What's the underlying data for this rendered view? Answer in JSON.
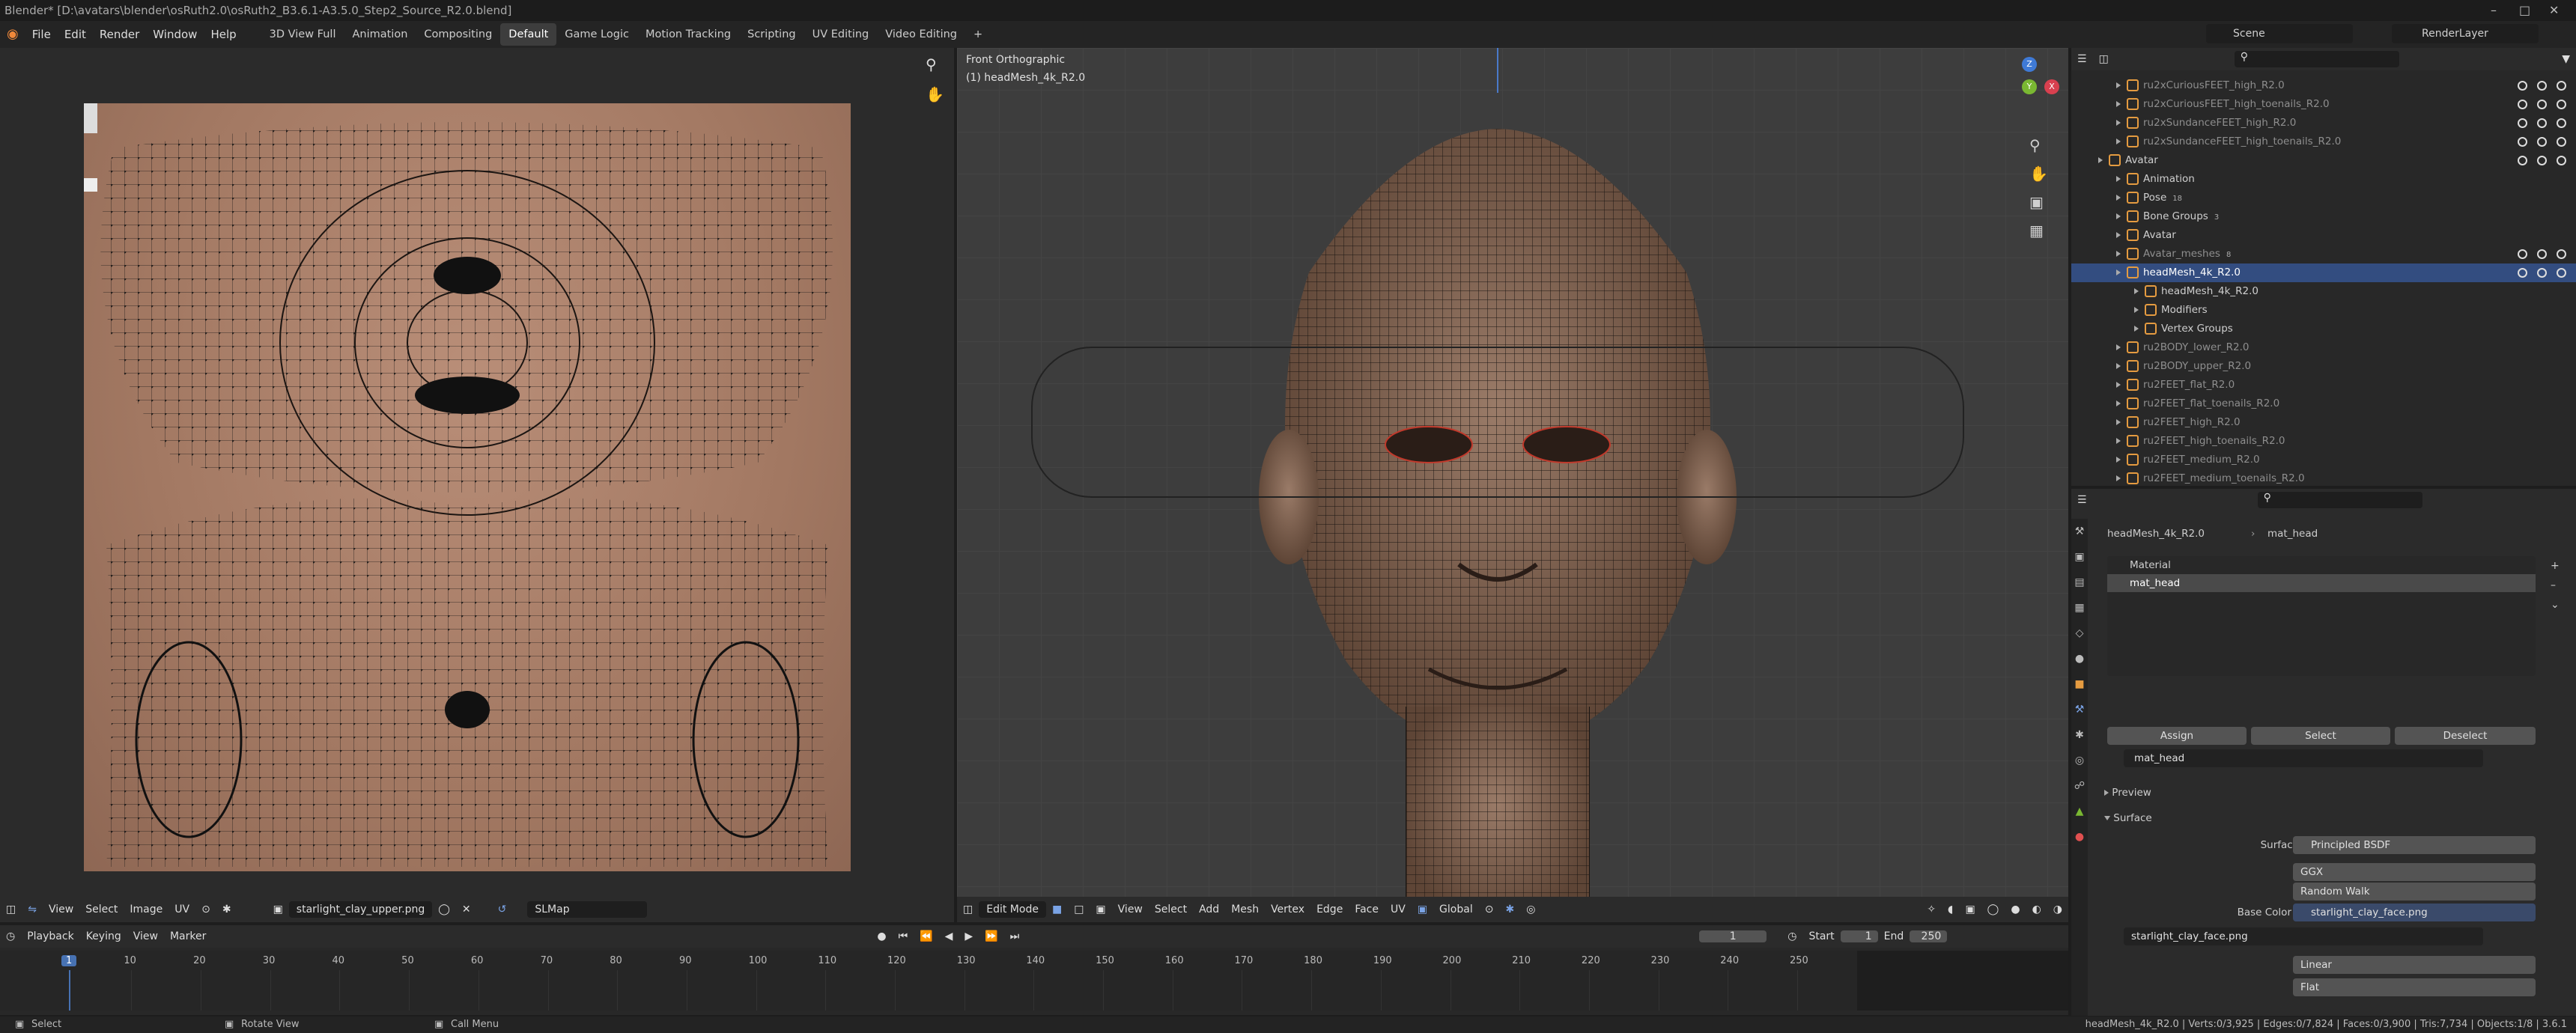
{
  "window": {
    "title": "Blender* [D:\\avatars\\blender\\osRuth2.0\\osRuth2_B3.6.1-A3.5.0_Step2_Source_R2.0.blend]"
  },
  "menu": [
    "File",
    "Edit",
    "Render",
    "Window",
    "Help"
  ],
  "workspaces": [
    "3D View Full",
    "Animation",
    "Compositing",
    "Default",
    "Game Logic",
    "Motion Tracking",
    "Scripting",
    "UV Editing",
    "Video Editing"
  ],
  "active_workspace": "Default",
  "scene": {
    "name": "Scene",
    "render_layer": "RenderLayer"
  },
  "uv_editor": {
    "menus": [
      "View",
      "Select",
      "Image",
      "UV"
    ],
    "image_name": "starlight_clay_upper.png",
    "uv_map": "SLMap"
  },
  "viewport": {
    "view_label": "Front Orthographic",
    "object_label": "(1) headMesh_4k_R2.0",
    "mode": "Edit Mode",
    "menus": [
      "View",
      "Select",
      "Add",
      "Mesh",
      "Vertex",
      "Edge",
      "Face",
      "UV"
    ],
    "orientation": "Global",
    "axes": {
      "x": "X",
      "y": "Y",
      "z": "Z"
    }
  },
  "outliner": {
    "rows": [
      {
        "label": "ru2xCuriousFEET_high_R2.0",
        "indent": 2,
        "dim": true
      },
      {
        "label": "ru2xCuriousFEET_high_toenails_R2.0",
        "indent": 2,
        "dim": true
      },
      {
        "label": "ru2xSundanceFEET_high_R2.0",
        "indent": 2,
        "dim": true
      },
      {
        "label": "ru2xSundanceFEET_high_toenails_R2.0",
        "indent": 2,
        "dim": true
      },
      {
        "label": "Avatar",
        "indent": 1,
        "dim": false
      },
      {
        "label": "Animation",
        "indent": 2,
        "dim": false
      },
      {
        "label": "Pose",
        "indent": 2,
        "dim": false,
        "badge": "18"
      },
      {
        "label": "Bone Groups",
        "indent": 2,
        "dim": false,
        "badge": "3"
      },
      {
        "label": "Avatar",
        "indent": 2,
        "dim": false
      },
      {
        "label": "Avatar_meshes",
        "indent": 2,
        "dim": true,
        "badge": "8"
      },
      {
        "label": "headMesh_4k_R2.0",
        "indent": 2,
        "dim": false,
        "selected": true
      },
      {
        "label": "headMesh_4k_R2.0",
        "indent": 3,
        "dim": false
      },
      {
        "label": "Modifiers",
        "indent": 3,
        "dim": false
      },
      {
        "label": "Vertex Groups",
        "indent": 3,
        "dim": false
      },
      {
        "label": "ru2BODY_lower_R2.0",
        "indent": 2,
        "dim": true
      },
      {
        "label": "ru2BODY_upper_R2.0",
        "indent": 2,
        "dim": true
      },
      {
        "label": "ru2FEET_flat_R2.0",
        "indent": 2,
        "dim": true
      },
      {
        "label": "ru2FEET_flat_toenails_R2.0",
        "indent": 2,
        "dim": true
      },
      {
        "label": "ru2FEET_high_R2.0",
        "indent": 2,
        "dim": true
      },
      {
        "label": "ru2FEET_high_toenails_R2.0",
        "indent": 2,
        "dim": true
      },
      {
        "label": "ru2FEET_medium_R2.0",
        "indent": 2,
        "dim": true
      },
      {
        "label": "ru2FEET_medium_toenails_R2.0",
        "indent": 2,
        "dim": true
      }
    ]
  },
  "properties": {
    "breadcrumb": {
      "object": "headMesh_4k_R2.0",
      "material": "mat_head"
    },
    "slots": [
      "Material",
      "mat_head"
    ],
    "buttons": {
      "assign": "Assign",
      "select": "Select",
      "deselect": "Deselect"
    },
    "material_name": "mat_head",
    "panels": {
      "preview": "Preview",
      "surface": "Surface"
    },
    "surface": {
      "label": "Surface",
      "value": "Principled BSDF"
    },
    "distribution": "GGX",
    "subsurface": "Random Walk",
    "base_color": {
      "label": "Base Color",
      "value": "starlight_clay_face.png"
    },
    "image": "starlight_clay_face.png",
    "interpolation": "Linear",
    "projection": "Flat"
  },
  "timeline": {
    "menus": [
      "Playback",
      "Keying",
      "View",
      "Marker"
    ],
    "current_frame": "1",
    "start_label": "Start",
    "start": "1",
    "end_label": "End",
    "end": "250",
    "ticks": [
      "1",
      "10",
      "20",
      "30",
      "40",
      "50",
      "60",
      "70",
      "80",
      "90",
      "100",
      "110",
      "120",
      "130",
      "140",
      "150",
      "160",
      "170",
      "180",
      "190",
      "200",
      "210",
      "220",
      "230",
      "240",
      "250"
    ]
  },
  "statusbar": {
    "left": "Select",
    "middle": "Rotate View",
    "right": "Call Menu",
    "stats": "headMesh_4k_R2.0 | Verts:0/3,925 | Edges:0/7,824 | Faces:0/3,900 | Tris:7,734 | Objects:1/8 | 3.6.1"
  }
}
